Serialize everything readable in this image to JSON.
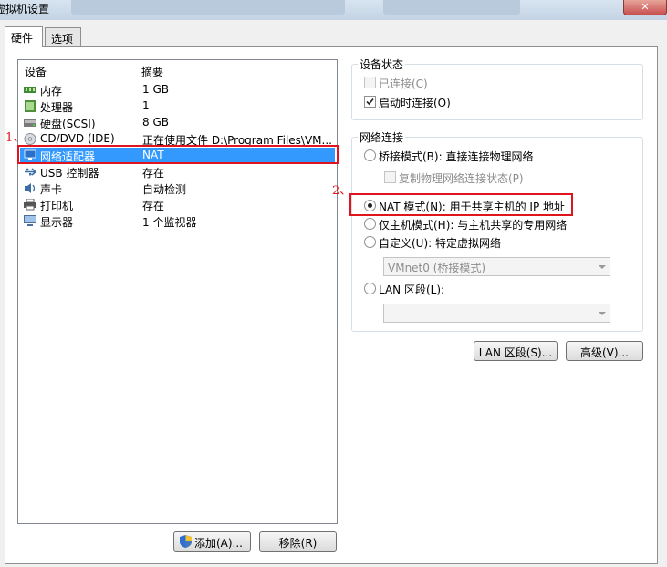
{
  "window": {
    "title": "虚拟机设置",
    "close_glyph": "✕"
  },
  "tabs": [
    {
      "label": "硬件"
    },
    {
      "label": "选项"
    }
  ],
  "device_list": {
    "headers": {
      "device": "设备",
      "summary": "摘要"
    },
    "rows": [
      {
        "name": "内存",
        "summary": "1 GB",
        "icon": "memory-icon"
      },
      {
        "name": "处理器",
        "summary": "1",
        "icon": "processor-icon"
      },
      {
        "name": "硬盘(SCSI)",
        "summary": "8 GB",
        "icon": "hard-disk-icon"
      },
      {
        "name": "CD/DVD (IDE)",
        "summary": "正在使用文件 D:\\Program Files\\VM...",
        "icon": "cd-dvd-icon"
      },
      {
        "name": "网络适配器",
        "summary": "NAT",
        "icon": "network-adapter-icon",
        "selected": true
      },
      {
        "name": "USB 控制器",
        "summary": "存在",
        "icon": "usb-icon"
      },
      {
        "name": "声卡",
        "summary": "自动检测",
        "icon": "sound-card-icon"
      },
      {
        "name": "打印机",
        "summary": "存在",
        "icon": "printer-icon"
      },
      {
        "name": "显示器",
        "summary": "1 个监视器",
        "icon": "display-icon"
      }
    ]
  },
  "buttons": {
    "add": "添加(A)...",
    "remove": "移除(R)",
    "lan_segments": "LAN 区段(S)...",
    "advanced": "高级(V)..."
  },
  "device_status": {
    "title": "设备状态",
    "connected": {
      "label": "已连接(C)",
      "checked": false,
      "disabled": true
    },
    "connect_at_power_on": {
      "label": "启动时连接(O)",
      "checked": true
    }
  },
  "network_connection": {
    "title": "网络连接",
    "bridged": "桥接模式(B): 直接连接物理网络",
    "replicate": "复制物理网络连接状态(P)",
    "nat": "NAT 模式(N): 用于共享主机的 IP 地址",
    "host_only": "仅主机模式(H): 与主机共享的专用网络",
    "custom": "自定义(U): 特定虚拟网络",
    "custom_select": "VMnet0 (桥接模式)",
    "lan_segment": "LAN 区段(L):",
    "lan_select": "",
    "selected": "nat"
  },
  "annotations": {
    "first": "1、",
    "second": "2、",
    "color": "#e0141c"
  },
  "colors": {
    "selection": "#3399ff"
  }
}
